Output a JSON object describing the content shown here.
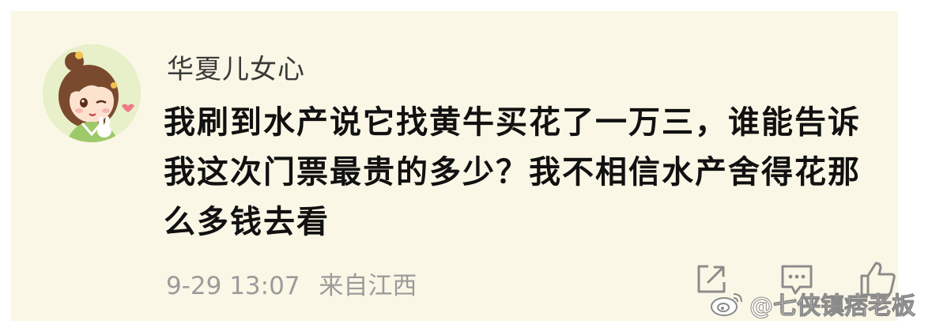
{
  "comment": {
    "username": "华夏儿女心",
    "text": "我刷到水产说它找黄牛买花了一万三，谁能告诉我这次门票最贵的多少？我不相信水产舍得花那么多钱去看",
    "date": "9-29 13:07",
    "location": "来自江西"
  },
  "actions": {
    "share_icon": "share-icon",
    "reply_icon": "comment-icon",
    "like_icon": "thumbs-up-icon"
  },
  "watermark": {
    "text": "@七侠镇痞老板",
    "logo_icon": "weibo-icon"
  },
  "colors": {
    "card_background": "#fbf7e6",
    "username": "#3a3a3a",
    "comment_text": "#111111",
    "meta_text": "#9b9b9b",
    "avatar_background": "#e7f0c9"
  }
}
